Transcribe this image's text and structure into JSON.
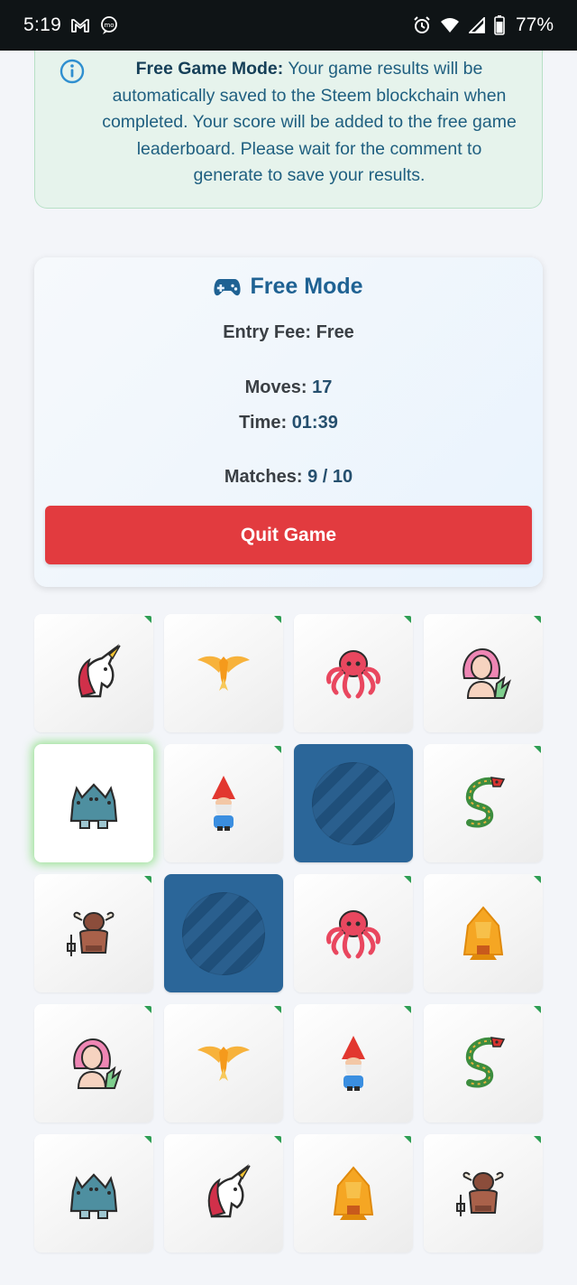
{
  "status_bar": {
    "time": "5:19",
    "battery": "77%",
    "icons": [
      "gmail-icon",
      "messaging-icon",
      "alarm-icon",
      "wifi-icon",
      "signal-icon",
      "battery-icon"
    ]
  },
  "notice": {
    "icon": "info-icon",
    "heading": "Free Game Mode:",
    "body": " Your game results will be automatically saved to the Steem blockchain when completed. Your score will be added to the free game leaderboard. Please wait for the comment to generate to save your results."
  },
  "panel": {
    "icon": "gamepad-icon",
    "title": "Free Mode",
    "entry_fee_label": "Entry Fee:",
    "entry_fee_value": "Free",
    "moves_label": "Moves:",
    "moves_value": "17",
    "time_label": "Time:",
    "time_value": "01:39",
    "matches_label": "Matches:",
    "matches_value": "9 / 10",
    "quit_label": "Quit Game"
  },
  "colors": {
    "accent_blue": "#1f6293",
    "quit_red": "#e23b3f",
    "matched_green": "#2e9e54",
    "card_back": "#2b6699"
  },
  "cards": [
    {
      "icon": "unicorn-icon",
      "state": "matched"
    },
    {
      "icon": "phoenix-icon",
      "state": "matched"
    },
    {
      "icon": "octopus-icon",
      "state": "matched"
    },
    {
      "icon": "mermaid-icon",
      "state": "matched"
    },
    {
      "icon": "cerberus-icon",
      "state": "selected"
    },
    {
      "icon": "gnome-icon",
      "state": "matched"
    },
    {
      "icon": "card-back-icon",
      "state": "facedown"
    },
    {
      "icon": "dragon-icon",
      "state": "matched"
    },
    {
      "icon": "minotaur-icon",
      "state": "matched"
    },
    {
      "icon": "card-back-icon",
      "state": "facedown"
    },
    {
      "icon": "octopus-icon",
      "state": "matched"
    },
    {
      "icon": "sphinx-icon",
      "state": "matched"
    },
    {
      "icon": "mermaid-icon",
      "state": "matched"
    },
    {
      "icon": "phoenix-icon",
      "state": "matched"
    },
    {
      "icon": "gnome-icon",
      "state": "matched"
    },
    {
      "icon": "dragon-icon",
      "state": "matched"
    },
    {
      "icon": "cerberus-icon",
      "state": "matched"
    },
    {
      "icon": "unicorn-icon",
      "state": "matched"
    },
    {
      "icon": "sphinx-icon",
      "state": "matched"
    },
    {
      "icon": "minotaur-icon",
      "state": "matched"
    }
  ]
}
